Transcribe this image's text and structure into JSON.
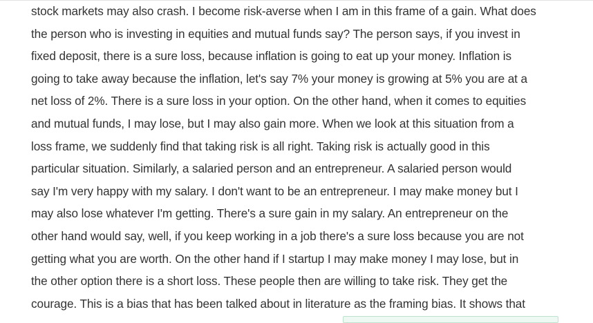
{
  "transcript": {
    "lines": [
      "stock markets may also crash. I become risk-averse when I am in this frame of a gain. What does",
      "the person who is investing in equities and mutual funds say? The person says, if you invest in",
      "fixed deposit, there is a sure loss, because inflation is going to eat up your money. Inflation is",
      "going to take away because the inflation, let's say 7% your money is growing at 5% you are at a",
      "net loss of 2%. There is a sure loss in your option. On the other hand, when it comes to equities",
      "and mutual funds, I may lose, but I may also gain more. When we look at this situation from a",
      "loss frame, we suddenly find that taking risk is all right. Taking risk is actually good in this",
      "particular situation. Similarly, a salaried person and an entrepreneur. A salaried person would",
      "say I'm very happy with my salary. I don't want to be an entrepreneur. I may make money but I",
      "may also lose whatever I'm getting. There's a sure gain in my salary. An entrepreneur on the",
      "other hand would say, well, if you keep working in a job there's a sure loss because you are not",
      "getting what you are worth. On the other hand if I startup I may make money I may lose, but in",
      "the other option there is a short loss. These people then are willing to take risk. They get the",
      "courage. This is a bias that has been talked about in literature as the framing bias. It shows that"
    ]
  },
  "colors": {
    "text": "#333333",
    "background": "#ffffff",
    "box_border": "#bde3cf",
    "box_fill": "#eef9f3"
  }
}
